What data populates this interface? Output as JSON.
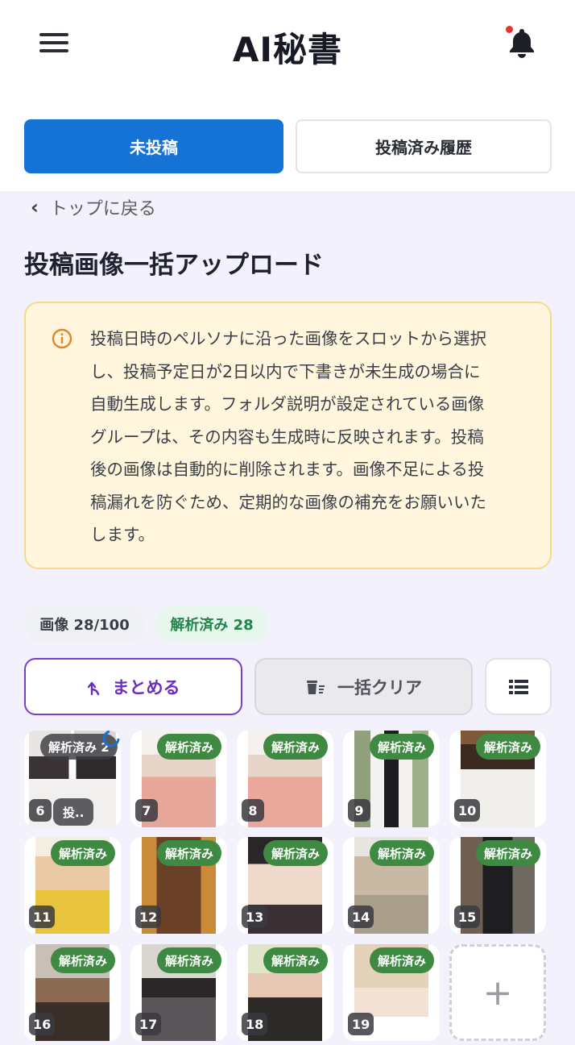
{
  "header": {
    "title": "AI秘書",
    "menu_icon": "hamburger-icon",
    "notification_icon": "bell-icon",
    "notification_dot_color": "#e3342f"
  },
  "tabs": [
    {
      "label": "未投稿",
      "active": true
    },
    {
      "label": "投稿済み履歴",
      "active": false
    }
  ],
  "back_link": {
    "label": "トップに戻る",
    "icon": "chevron-left-icon"
  },
  "page_title": "投稿画像一括アップロード",
  "notice": {
    "icon": "info-icon",
    "lines": [
      "投稿日時のペルソナに沿った画像をスロットから選択",
      "し、投稿予定日が2日以内で下書きが未生成の場合に",
      "自動生成します。フォルダ説明が設定されている画像",
      "グループは、その内容も生成時に反映されます。投稿",
      "後の画像は自動的に削除されます。画像不足による投",
      "稿漏れを防ぐため、定期的な画像の補充をお願いいた",
      "します。"
    ]
  },
  "stats": {
    "image_count": "画像 28/100",
    "analyzed_count": "解析済み 28"
  },
  "actions": {
    "merge_label": "まとめる",
    "clear_label": "一括クリア",
    "list_view_icon": "list-view-icon"
  },
  "grid": {
    "analyzed_label": "解析済み",
    "first_tile": {
      "number": "6",
      "tag": "解析済み 2",
      "posted_label": "投.."
    },
    "tiles": [
      {
        "number": "7"
      },
      {
        "number": "8"
      },
      {
        "number": "9"
      },
      {
        "number": "10"
      },
      {
        "number": "11"
      },
      {
        "number": "12"
      },
      {
        "number": "13"
      },
      {
        "number": "14"
      },
      {
        "number": "15"
      },
      {
        "number": "16"
      },
      {
        "number": "17"
      },
      {
        "number": "18"
      },
      {
        "number": "19"
      }
    ],
    "add_label": "+"
  },
  "colors": {
    "primary": "#1673d6",
    "accent_purple": "#6b2fc0",
    "analyzed_green": "#3f8a42",
    "notice_bg": "#fff6dd"
  }
}
